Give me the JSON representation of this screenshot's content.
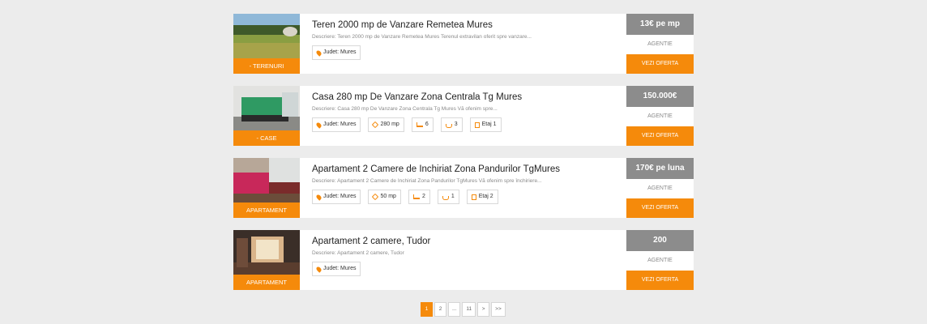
{
  "listings": [
    {
      "title": "Teren 2000 mp de Vanzare Remetea Mures",
      "description": "Descriere: Teren 2000 mp de Vanzare Remetea Mures Terenul extravilan oferit spre vanzare...",
      "category": "- TERENURI",
      "price": "13€ pe mp",
      "agency": "AGENTIE",
      "cta": "VEZI OFERTA",
      "features": [
        {
          "icon": "location-pin-icon",
          "text": "Judet: Mures"
        }
      ]
    },
    {
      "title": "Casa 280 mp De Vanzare Zona Centrala Tg Mures",
      "description": "Descriere: Casa 280 mp De Vanzare Zona Centrala Tg Mures Vă ofenim spre...",
      "category": "- CASE",
      "price": "150.000€",
      "agency": "AGENTIE",
      "cta": "VEZI OFERTA",
      "features": [
        {
          "icon": "location-pin-icon",
          "text": "Judet: Mures"
        },
        {
          "icon": "area-icon",
          "text": "280 mp"
        },
        {
          "icon": "bed-icon",
          "text": "6"
        },
        {
          "icon": "bath-icon",
          "text": "3"
        },
        {
          "icon": "floor-icon",
          "text": "Etaj 1"
        }
      ]
    },
    {
      "title": "Apartament 2 Camere de Inchiriat Zona Pandurilor TgMures",
      "description": "Descriere: Apartament 2 Camere de Inchiriat Zona Pandurilor TgMures Vă ofenim spre închiriere...",
      "category": "APARTAMENT",
      "price": "170€ pe luna",
      "agency": "AGENTIE",
      "cta": "VEZI OFERTA",
      "features": [
        {
          "icon": "location-pin-icon",
          "text": "Judet: Mures"
        },
        {
          "icon": "area-icon",
          "text": "50 mp"
        },
        {
          "icon": "bed-icon",
          "text": "2"
        },
        {
          "icon": "bath-icon",
          "text": "1"
        },
        {
          "icon": "floor-icon",
          "text": "Etaj 2"
        }
      ]
    },
    {
      "title": "Apartament 2 camere, Tudor",
      "description": "Descriere: Apartament 2 camere, Tudor",
      "category": "APARTAMENT",
      "price": "200",
      "agency": "AGENTIE",
      "cta": "VEZI OFERTA",
      "features": [
        {
          "icon": "location-pin-icon",
          "text": "Judet: Mures"
        }
      ]
    }
  ],
  "pagination": [
    "1",
    "2",
    "...",
    "11",
    ">",
    ">>"
  ],
  "colors": {
    "accent": "#f58a0b",
    "price_bg": "#8c8c8c",
    "page_bg": "#ececec"
  }
}
